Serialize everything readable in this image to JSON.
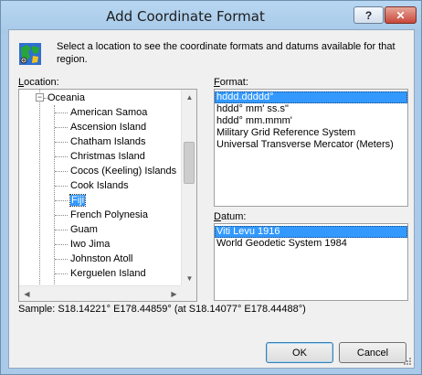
{
  "window": {
    "title": "Add Coordinate Format",
    "help_label": "?",
    "close_label": "✕"
  },
  "intro_text": "Select a location to see the coordinate formats and datums available for that region.",
  "location": {
    "label_prefix": "",
    "label_mnemonic": "L",
    "label_rest": "ocation:",
    "parent_node": "Oceania",
    "parent_expander": "−",
    "items": [
      "American Samoa",
      "Ascension Island",
      "Chatham Islands",
      "Christmas Island",
      "Cocos (Keeling) Islands",
      "Cook Islands",
      "Fiji",
      "French Polynesia",
      "Guam",
      "Iwo Jima",
      "Johnston Atoll",
      "Kerguelen Island"
    ],
    "selected": "Fiji"
  },
  "format": {
    "label_mnemonic": "F",
    "label_rest": "ormat:",
    "items": [
      "hddd.ddddd°",
      "hddd° mm' ss.s\"",
      "hddd° mm.mmm'",
      "Military Grid Reference System",
      "Universal Transverse Mercator (Meters)"
    ],
    "selected": "hddd.ddddd°"
  },
  "datum": {
    "label_mnemonic": "D",
    "label_rest": "atum:",
    "items": [
      "Viti Levu 1916",
      "World Geodetic System 1984"
    ],
    "selected": "Viti Levu 1916"
  },
  "sample_text": "Sample: S18.14221° E178.44859° (at S18.14077° E178.44488°)",
  "buttons": {
    "ok": "OK",
    "cancel": "Cancel"
  },
  "colors": {
    "selection": "#3399ff",
    "title_bar": "#a9cbe9",
    "close_button": "#c8473a"
  }
}
